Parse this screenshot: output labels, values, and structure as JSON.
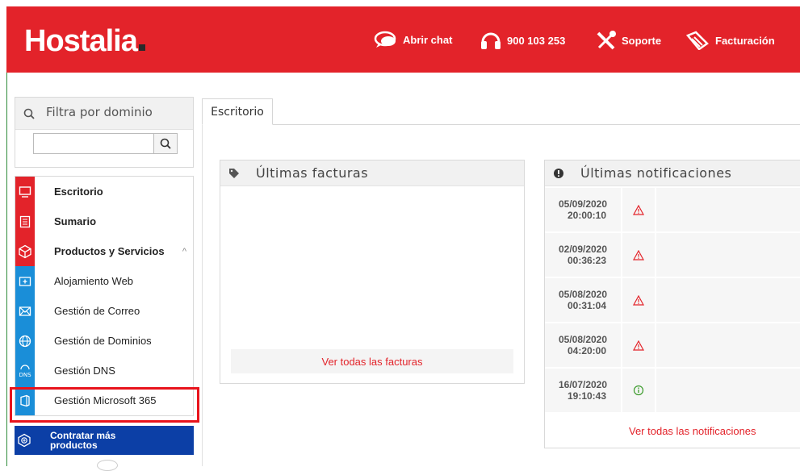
{
  "header": {
    "logo": "Hostalia",
    "chat_label": "Abrir chat",
    "phone_label": "900 103 253",
    "support_label": "Soporte",
    "billing_label": "Facturación"
  },
  "sidebar": {
    "filter_title": "Filtra por dominio",
    "search_value": "",
    "items": [
      {
        "label": "Escritorio",
        "icon": "monitor-icon"
      },
      {
        "label": "Sumario",
        "icon": "list-icon"
      },
      {
        "label": "Productos y Servicios",
        "icon": "cube-icon"
      },
      {
        "label": "Alojamiento Web",
        "icon": "plus-box-icon"
      },
      {
        "label": "Gestión de Correo",
        "icon": "mail-icon"
      },
      {
        "label": "Gestión de Dominios",
        "icon": "globe-icon"
      },
      {
        "label": "Gestión DNS",
        "icon": "dns-icon"
      },
      {
        "label": "Gestión Microsoft 365",
        "icon": "office-icon"
      }
    ],
    "cta_label_line1": "Contratar más",
    "cta_label_line2": "productos"
  },
  "main": {
    "tab_label": "Escritorio",
    "invoices": {
      "title": "Últimas facturas",
      "link": "Ver todas las facturas"
    },
    "notifications": {
      "title": "Últimas notificaciones",
      "rows": [
        {
          "date": "05/09/2020",
          "time": "20:00:10",
          "status": "warning"
        },
        {
          "date": "02/09/2020",
          "time": "00:36:23",
          "status": "warning"
        },
        {
          "date": "05/08/2020",
          "time": "00:31:04",
          "status": "warning"
        },
        {
          "date": "05/08/2020",
          "time": "04:20:00",
          "status": "warning"
        },
        {
          "date": "16/07/2020",
          "time": "19:10:43",
          "status": "info"
        }
      ],
      "link": "Ver todas las notificaciones"
    }
  },
  "colors": {
    "brand_red": "#e3232a",
    "menu_blue": "#1a8ed8",
    "cta_blue": "#0c3fa6",
    "highlight": "#e8141c",
    "info_green": "#3a9a2a"
  }
}
